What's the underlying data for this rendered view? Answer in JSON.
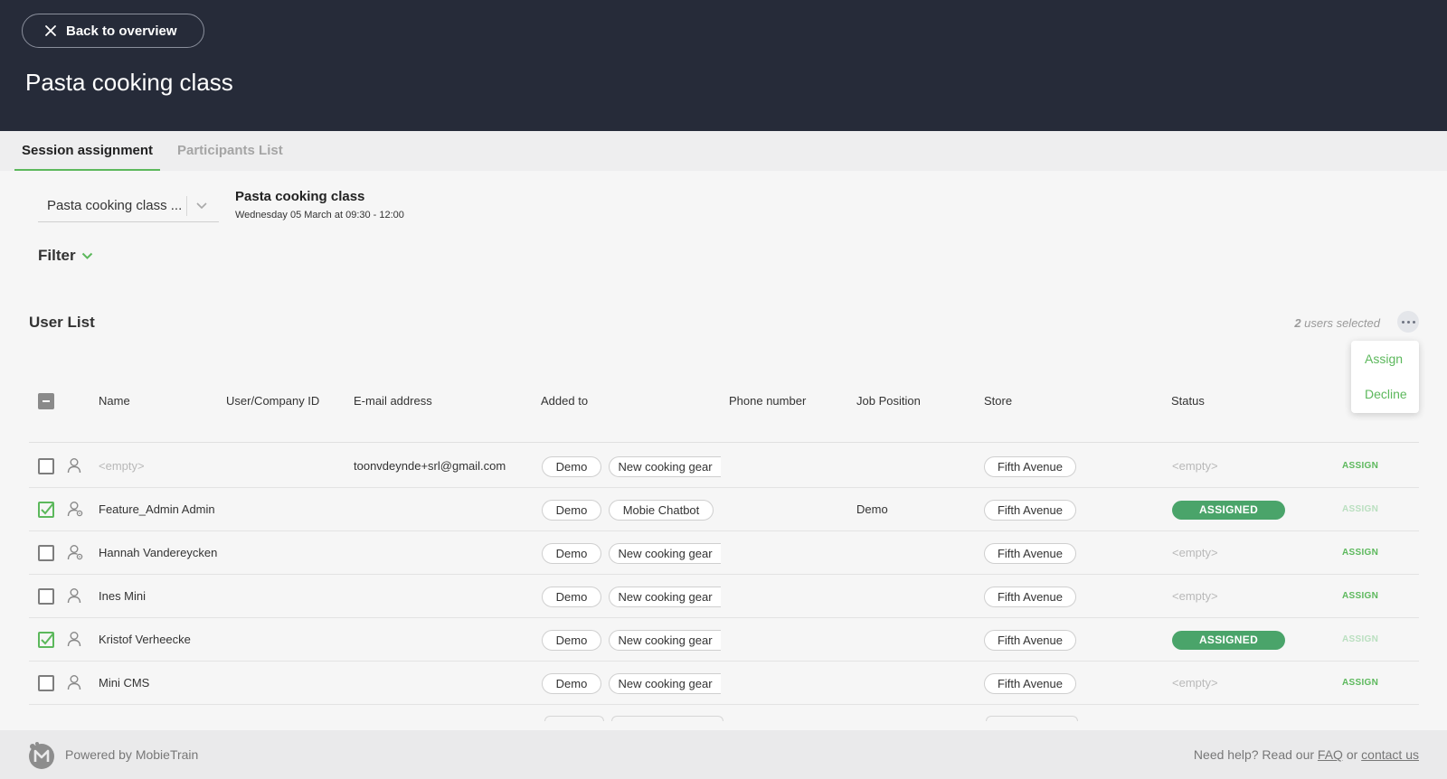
{
  "header": {
    "back_label": "Back to overview",
    "title": "Pasta cooking class"
  },
  "tabs": [
    {
      "label": "Session assignment",
      "active": true
    },
    {
      "label": "Participants List",
      "active": false
    }
  ],
  "session": {
    "select_value": "Pasta cooking class ...",
    "title": "Pasta cooking class",
    "datetime": "Wednesday 05 March at 09:30 - 12:00"
  },
  "filter_label": "Filter",
  "user_list": {
    "title": "User List",
    "selected_count": "2",
    "selected_suffix": " users selected",
    "menu": [
      "Assign",
      "Decline"
    ],
    "columns": [
      "Name",
      "User/Company ID",
      "E-mail address",
      "Added to",
      "Phone number",
      "Job Position",
      "Store",
      "Status"
    ],
    "rows": [
      {
        "checked": false,
        "icon": "user-icon",
        "name": "<empty>",
        "name_empty": true,
        "user_id": "",
        "email": "toonvdeynde+srl@gmail.com",
        "added_to": [
          "Demo",
          "New cooking gear"
        ],
        "phone": "",
        "job": "",
        "store": "Fifth Avenue",
        "status": "<empty>",
        "assigned": false,
        "action": "ASSIGN"
      },
      {
        "checked": true,
        "icon": "user-admin-icon",
        "name": "Feature_Admin Admin",
        "name_empty": false,
        "user_id": "",
        "email": "",
        "added_to": [
          "Demo",
          "Mobie Chatbot"
        ],
        "phone": "",
        "job": "Demo",
        "store": "Fifth Avenue",
        "status": "ASSIGNED",
        "assigned": true,
        "action": "ASSIGN"
      },
      {
        "checked": false,
        "icon": "user-admin-icon",
        "name": "Hannah Vandereycken",
        "name_empty": false,
        "user_id": "",
        "email": "",
        "added_to": [
          "Demo",
          "New cooking gear"
        ],
        "phone": "",
        "job": "",
        "store": "Fifth Avenue",
        "status": "<empty>",
        "assigned": false,
        "action": "ASSIGN"
      },
      {
        "checked": false,
        "icon": "user-icon",
        "name": "Ines Mini",
        "name_empty": false,
        "user_id": "",
        "email": "",
        "added_to": [
          "Demo",
          "New cooking gear"
        ],
        "phone": "",
        "job": "",
        "store": "Fifth Avenue",
        "status": "<empty>",
        "assigned": false,
        "action": "ASSIGN"
      },
      {
        "checked": true,
        "icon": "user-icon",
        "name": "Kristof Verheecke",
        "name_empty": false,
        "user_id": "",
        "email": "",
        "added_to": [
          "Demo",
          "New cooking gear"
        ],
        "phone": "",
        "job": "",
        "store": "Fifth Avenue",
        "status": "ASSIGNED",
        "assigned": true,
        "action": "ASSIGN"
      },
      {
        "checked": false,
        "icon": "user-icon",
        "name": "Mini CMS",
        "name_empty": false,
        "user_id": "",
        "email": "",
        "added_to": [
          "Demo",
          "New cooking gear"
        ],
        "phone": "",
        "job": "",
        "store": "Fifth Avenue",
        "status": "<empty>",
        "assigned": false,
        "action": "ASSIGN"
      }
    ]
  },
  "footer": {
    "powered": "Powered by MobieTrain",
    "help_prefix": "Need help? Read our ",
    "faq": "FAQ",
    "or": " or ",
    "contact": "contact us"
  },
  "colors": {
    "header_bg": "#262b39",
    "accent_green": "#5cb85c",
    "assigned_badge": "#4aa46a"
  }
}
